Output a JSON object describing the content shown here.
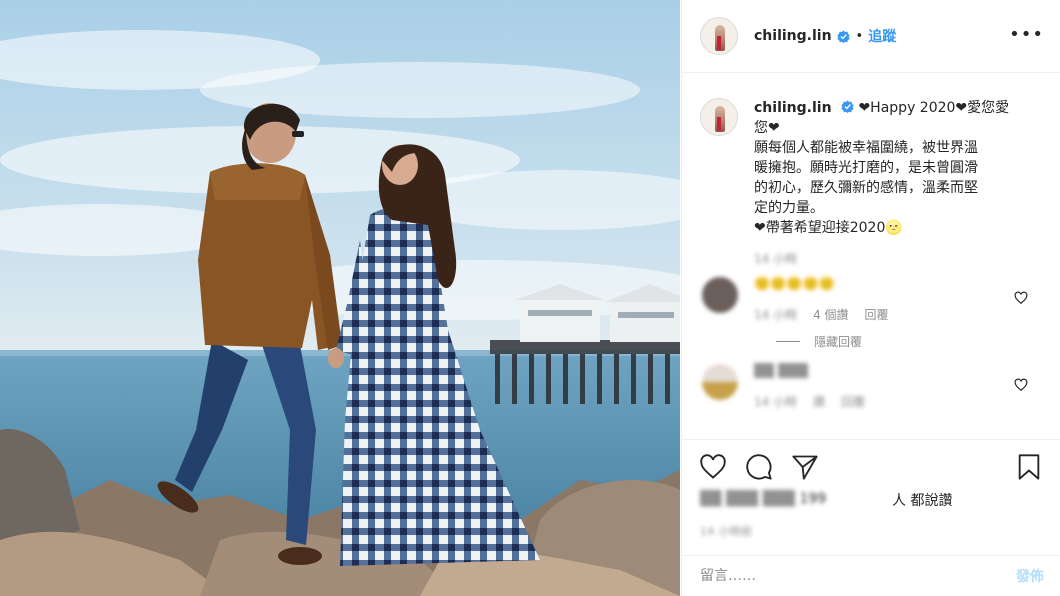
{
  "post": {
    "username": "chiling.lin",
    "verified": true,
    "separator": "•",
    "follow_label": "追蹤",
    "more_label": "•••"
  },
  "caption": {
    "username": "chiling.lin",
    "lines": [
      "❤Happy 2020❤愛您愛",
      "您❤",
      "願每個人都能被幸福圍繞，被世界溫",
      "暖擁抱。願時光打磨的，是未曾圓滑",
      "的初心，歷久彌新的感情，溫柔而堅",
      "定的力量。",
      "❤帶著希望迎接2020🌝"
    ],
    "time": "14 小時"
  },
  "comments": [
    {
      "text": "🙂🙂🙂🙂🙂",
      "time": "14 小時",
      "likes": "4 個讚",
      "reply_label": "回覆",
      "hide_replies_label": "隱藏回覆",
      "avatar_color": "#6b5f5b"
    },
    {
      "text": "▒▒ ▒▒▒",
      "time": "14 小時",
      "likes": "讚",
      "reply_label": "回覆",
      "avatar_color": "#c7a24a"
    }
  ],
  "likes": {
    "blurred": "▒▒ ▒▒▒ ▒▒▒ 199",
    "suffix": "人 都說讚"
  },
  "posted_ago": "14 小時前",
  "composer": {
    "placeholder": "留言……",
    "post_label": "發佈"
  },
  "colors": {
    "link_blue": "#3897f0",
    "post_disabled": "#b2dffc",
    "verified_blue": "#3897f0"
  },
  "icons": [
    "heart-icon",
    "comment-icon",
    "share-icon",
    "bookmark-icon",
    "verified-badge-icon",
    "more-options-icon"
  ]
}
